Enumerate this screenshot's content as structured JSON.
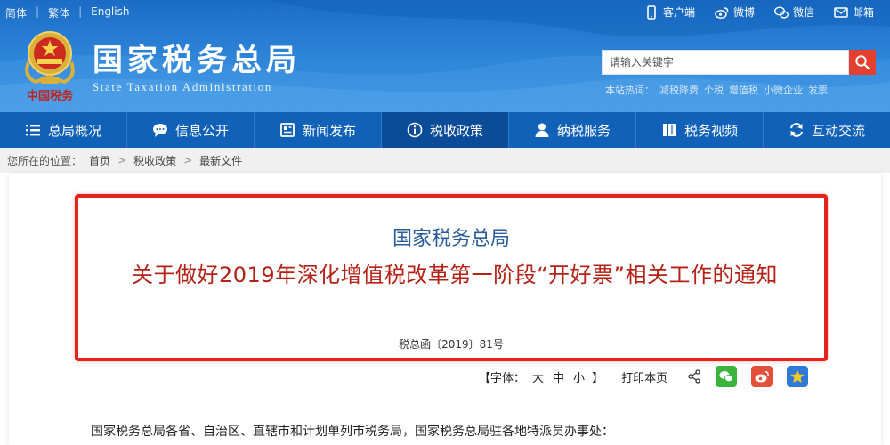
{
  "lang": {
    "simplified": "简体",
    "traditional": "繁体",
    "english": "English",
    "separator": "|"
  },
  "toplinks": {
    "client": "客户端",
    "weibo": "微博",
    "wechat": "微信",
    "email": "邮箱"
  },
  "site": {
    "title": "国家税务总局",
    "subtitle": "State Taxation Administration",
    "logo_text": "中国税务"
  },
  "search": {
    "placeholder": "请输入关键字",
    "hot_label": "本站热词：",
    "hot_words": [
      "减税降费",
      "个税",
      "增值税",
      "小微企业",
      "发票"
    ]
  },
  "nav": [
    {
      "label": "总局概况",
      "icon": "menu-icon"
    },
    {
      "label": "信息公开",
      "icon": "chat-icon"
    },
    {
      "label": "新闻发布",
      "icon": "news-icon"
    },
    {
      "label": "税收政策",
      "icon": "info-icon"
    },
    {
      "label": "纳税服务",
      "icon": "user-icon"
    },
    {
      "label": "税务视频",
      "icon": "video-icon"
    },
    {
      "label": "互动交流",
      "icon": "exchange-icon"
    }
  ],
  "nav_active": 3,
  "breadcrumb": {
    "prefix": "您所在的位置：",
    "items": [
      "首页",
      "税收政策",
      "最新文件"
    ],
    "sep": ">"
  },
  "article": {
    "org": "国家税务总局",
    "title": "关于做好2019年深化增值税改革第一阶段“开好票”相关工作的通知",
    "doc_no": "税总函〔2019〕81号",
    "font_label_open": "【字体：",
    "font_sizes": [
      "大",
      "中",
      "小"
    ],
    "font_label_close": "】",
    "print": "打印本页",
    "salutation": "国家税务总局各省、自治区、直辖市和计划单列市税务局，国家税务总局驻各地特派员办事处："
  },
  "colors": {
    "nav_bg": "#1261b8",
    "nav_active": "#0b4c99",
    "title_red": "#b32217",
    "org_blue": "#2a5c9c",
    "box_red": "#e2241b"
  }
}
